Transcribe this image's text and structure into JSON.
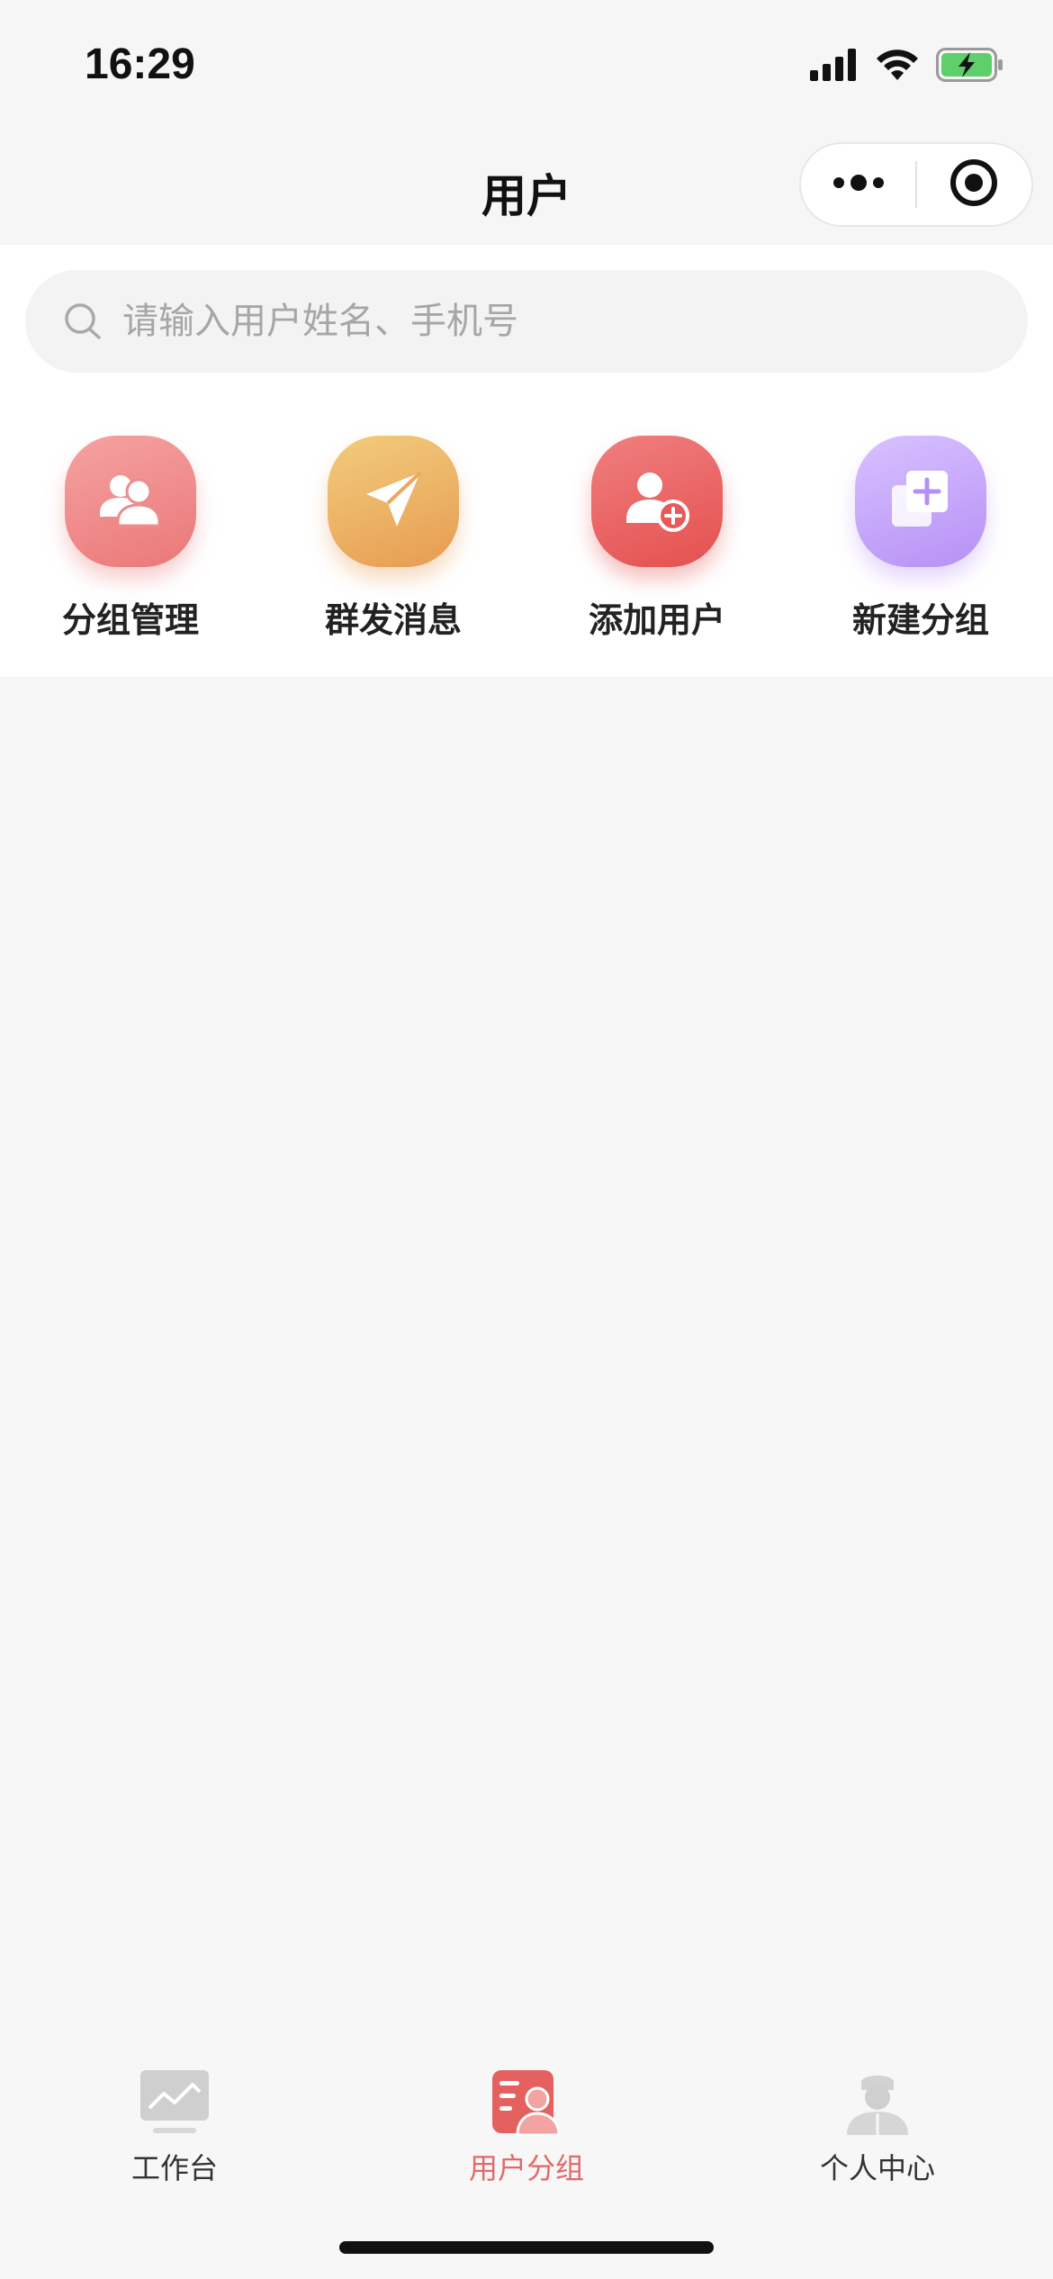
{
  "status_bar": {
    "time": "16:29",
    "icons": [
      "signal-icon",
      "wifi-icon",
      "battery-charging-icon"
    ],
    "battery_color": "#5fcf6b"
  },
  "nav": {
    "title": "用户",
    "capsule_icons": [
      "more-dots-icon",
      "close-target-icon"
    ]
  },
  "search": {
    "placeholder": "请输入用户姓名、手机号",
    "value": "",
    "icon": "search-icon"
  },
  "quick_actions": [
    {
      "label": "分组管理",
      "icon": "users-group-icon",
      "color": "#eb7878"
    },
    {
      "label": "群发消息",
      "icon": "send-plane-icon",
      "color": "#e79c52"
    },
    {
      "label": "添加用户",
      "icon": "user-add-icon",
      "color": "#e4504f"
    },
    {
      "label": "新建分组",
      "icon": "new-group-icon",
      "color": "#b690f5"
    }
  ],
  "tabs": [
    {
      "label": "工作台",
      "icon": "workbench-monitor-icon",
      "active": false
    },
    {
      "label": "用户分组",
      "icon": "user-group-list-icon",
      "active": true
    },
    {
      "label": "个人中心",
      "icon": "doctor-profile-icon",
      "active": false
    }
  ],
  "colors": {
    "accent": "#e26a6a",
    "background": "#f6f6f6",
    "panel": "#ffffff"
  }
}
